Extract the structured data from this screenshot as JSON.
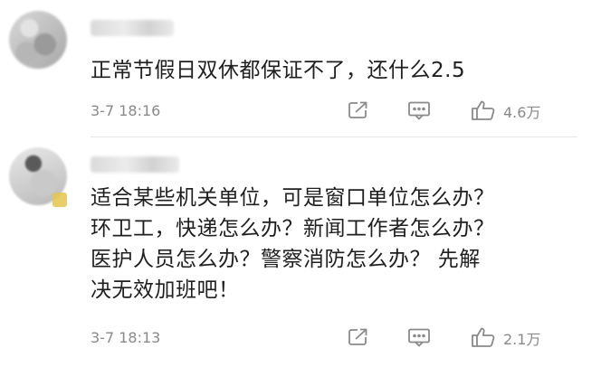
{
  "comments": [
    {
      "username": "",
      "text_lines": [
        "正常节假日双休都保证不了，还什么2.5"
      ],
      "time": "3-7 18:16",
      "likes": "4.6万",
      "icons": {
        "share": "share-icon",
        "reply": "comment-icon",
        "like": "thumbs-up-icon"
      }
    },
    {
      "username": "",
      "text_lines": [
        "适合某些机关单位，可是窗口单位怎么办？",
        "环卫工，快递怎么办？新闻工作者怎么办？",
        "医护人员怎么办？警察消防怎么办？ 先解",
        "决无效加班吧！"
      ],
      "time": "3-7 18:13",
      "likes": "2.1万",
      "icons": {
        "share": "share-icon",
        "reply": "comment-icon",
        "like": "thumbs-up-icon"
      }
    }
  ],
  "colors": {
    "text": "#1f1f1f",
    "meta": "#8a8a8a",
    "divider": "#e6e6e6",
    "vip_badge": "#e5c44d"
  }
}
